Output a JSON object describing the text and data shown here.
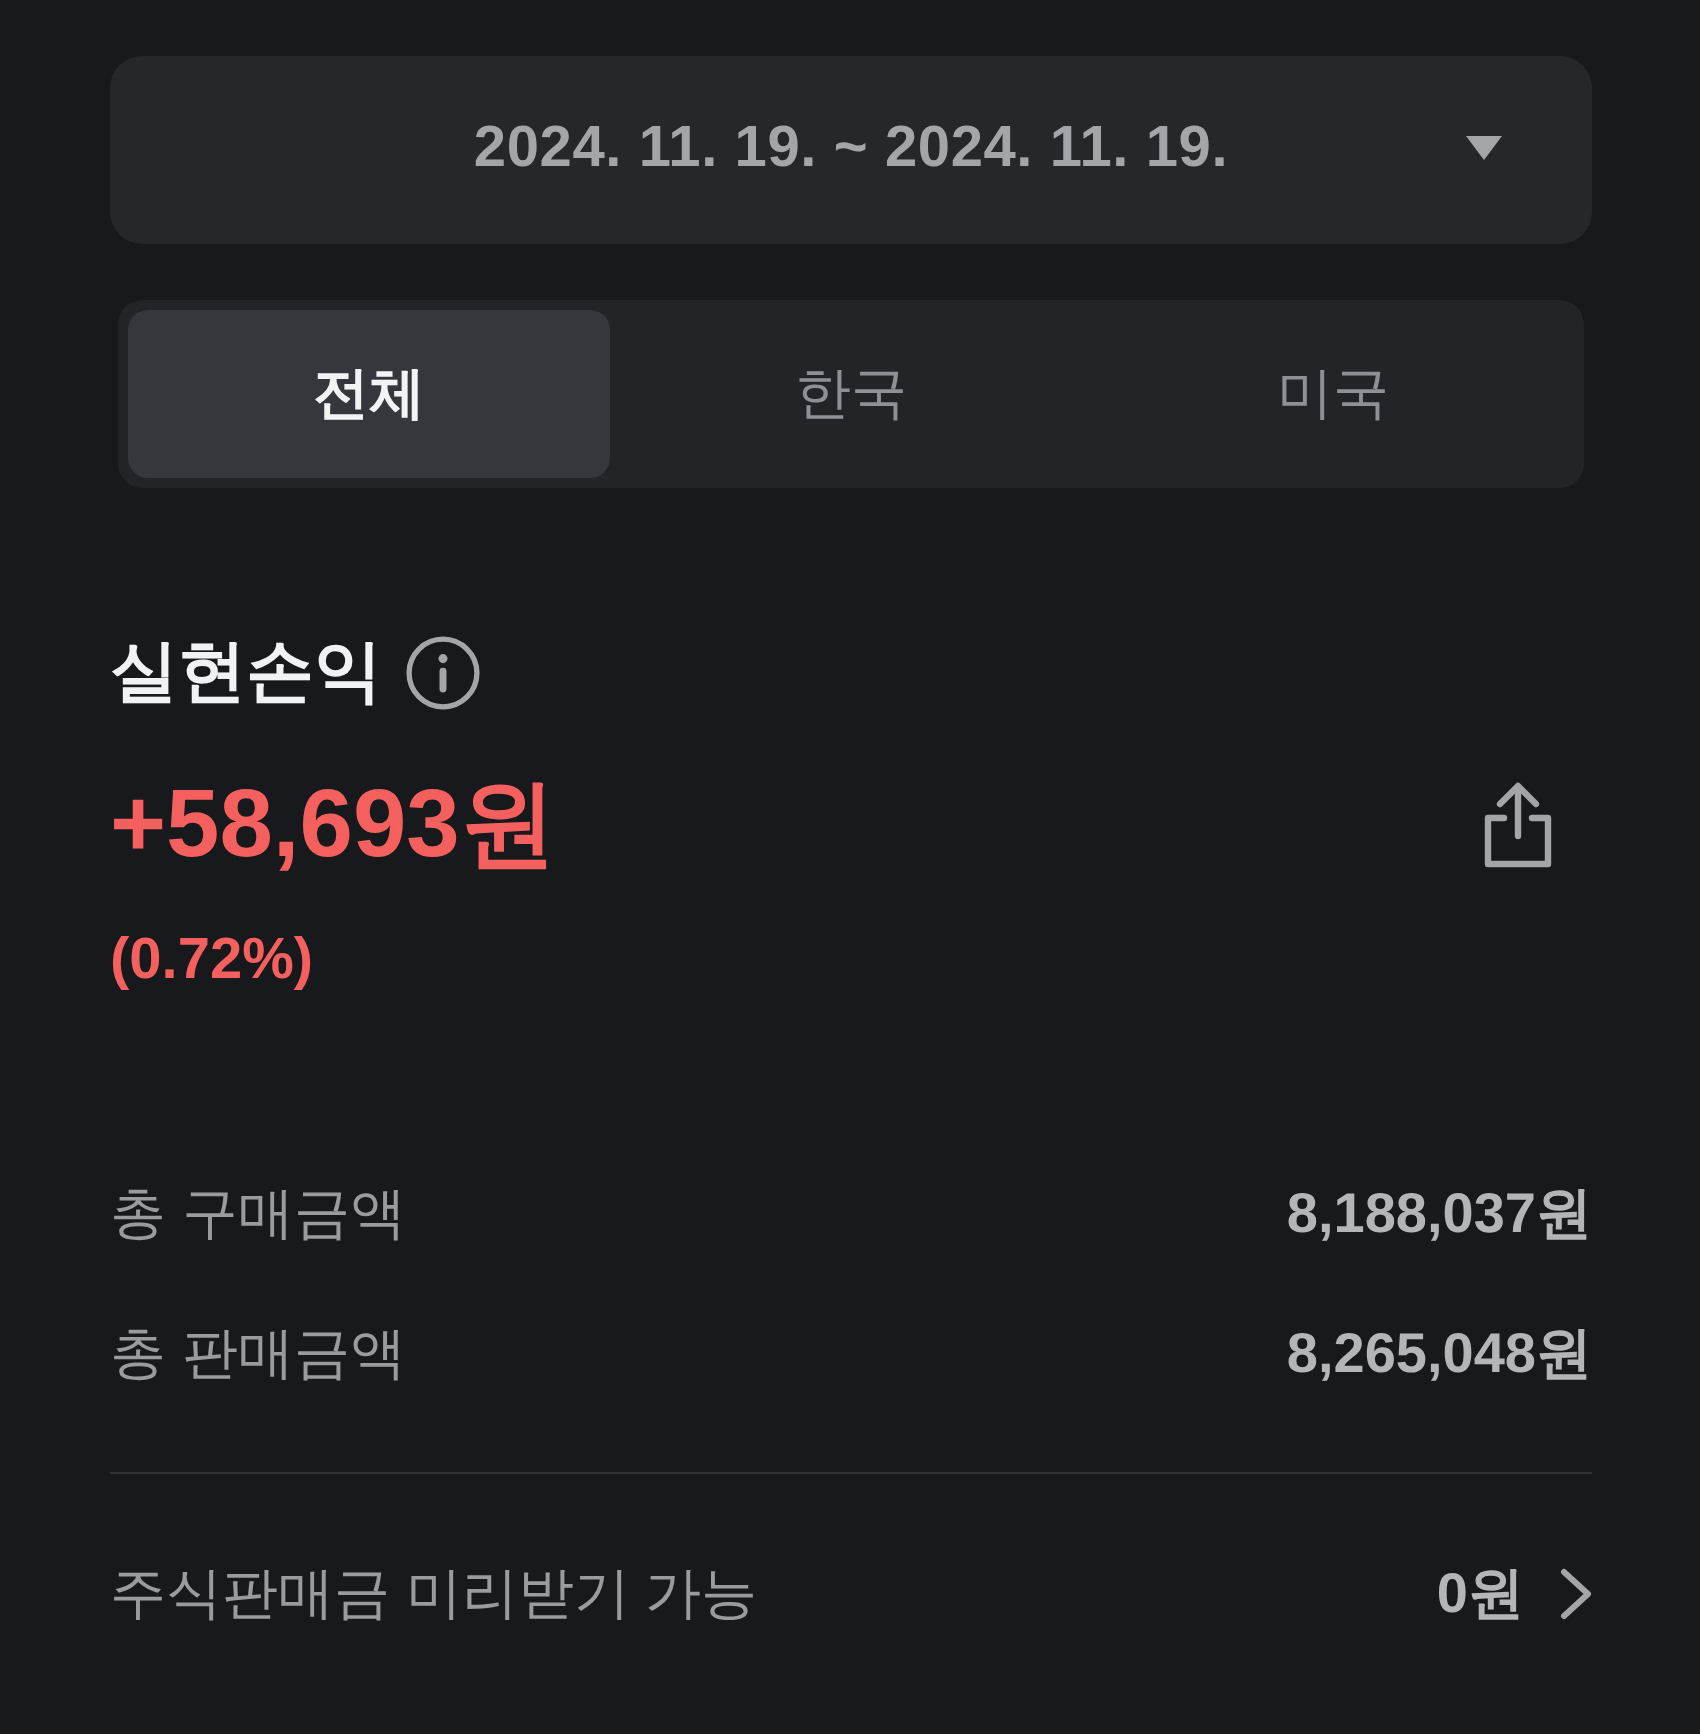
{
  "date_range": {
    "label": "2024. 11. 19. ~ 2024. 11. 19."
  },
  "tabs": [
    {
      "label": "전체",
      "selected": true
    },
    {
      "label": "한국",
      "selected": false
    },
    {
      "label": "미국",
      "selected": false
    }
  ],
  "realized_pnl": {
    "title": "실현손익",
    "amount": "+58,693원",
    "rate": "(0.72%)"
  },
  "summary": [
    {
      "label": "총 구매금액",
      "value": "8,188,037원"
    },
    {
      "label": "총 판매금액",
      "value": "8,265,048원"
    }
  ],
  "advance": {
    "label": "주식판매금 미리받기 가능",
    "value": "0원"
  }
}
